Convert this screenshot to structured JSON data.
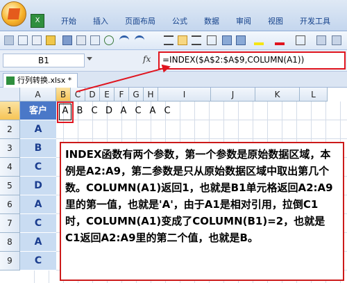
{
  "ribbon": {
    "tabs": [
      "开始",
      "插入",
      "页面布局",
      "公式",
      "数据",
      "审阅",
      "视图",
      "开发工具"
    ]
  },
  "formula_bar": {
    "name_box": "B1",
    "fx_label": "fx",
    "formula": "=INDEX($A$2:$A$9,COLUMN(A1))"
  },
  "document": {
    "tab_label": "行列转换.xlsx *"
  },
  "sheet": {
    "columns": [
      "A",
      "B",
      "C",
      "D",
      "E",
      "F",
      "G",
      "H",
      "I",
      "J",
      "K",
      "L"
    ],
    "rows": [
      "1",
      "2",
      "3",
      "4",
      "5",
      "6",
      "7",
      "8",
      "9"
    ],
    "column_a": [
      "客户",
      "A",
      "B",
      "C",
      "D",
      "A",
      "C",
      "A",
      "C"
    ],
    "row1_values": [
      "A",
      "B",
      "C",
      "D",
      "A",
      "C",
      "A",
      "C"
    ]
  },
  "callout": {
    "text": "INDEX函数有两个参数，第一个参数是原始数据区域，本例是A2:A9，第二参数是只从原始数据区域中取出第几个数。COLUMN(A1)返回1，也就是B1单元格返回A2:A9里的第一值，也就是'A'，由于A1是相对引用，拉倒C1时，COLUMN(A1)变成了COLUMN(B1)=2，也就是C1返回A2:A9里的第二个值，也就是B。"
  },
  "colors": {
    "highlight_red": "#e0141e",
    "header_blue": "#4a78c8",
    "cell_blue": "#c9dcf2"
  }
}
